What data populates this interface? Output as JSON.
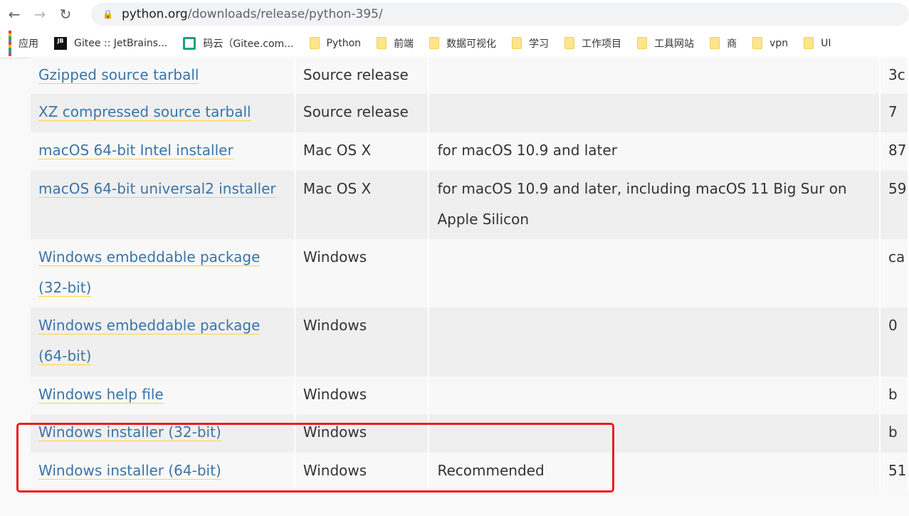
{
  "browser": {
    "url_host": "python.org",
    "url_path": "/downloads/release/python-395/",
    "bookmarks": [
      {
        "label": "应用",
        "icon": "apps-grid-icon"
      },
      {
        "label": "Gitee :: JetBrains...",
        "icon": "jetbrains-icon"
      },
      {
        "label": "码云（Gitee.com...",
        "icon": "gitee-icon"
      },
      {
        "label": "Python",
        "icon": "folder-icon"
      },
      {
        "label": "前端",
        "icon": "folder-icon"
      },
      {
        "label": "数据可视化",
        "icon": "folder-icon"
      },
      {
        "label": "学习",
        "icon": "folder-icon"
      },
      {
        "label": "工作项目",
        "icon": "folder-icon"
      },
      {
        "label": "工具网站",
        "icon": "folder-icon"
      },
      {
        "label": "商",
        "icon": "folder-icon"
      },
      {
        "label": "vpn",
        "icon": "folder-icon"
      },
      {
        "label": "UI",
        "icon": "folder-icon"
      }
    ]
  },
  "files": [
    {
      "version": "Gzipped source tarball",
      "os": "Source release",
      "description": "",
      "md5": "3c"
    },
    {
      "version": "XZ compressed source tarball",
      "os": "Source release",
      "description": "",
      "md5": "7"
    },
    {
      "version": "macOS 64-bit Intel installer",
      "os": "Mac OS X",
      "description": "for macOS 10.9 and later",
      "md5": "87"
    },
    {
      "version": "macOS 64-bit universal2 installer",
      "os": "Mac OS X",
      "description": "for macOS 10.9 and later, including macOS 11 Big Sur on Apple Silicon",
      "md5": "59"
    },
    {
      "version": "Windows embeddable package (32-bit)",
      "os": "Windows",
      "description": "",
      "md5": "ca"
    },
    {
      "version": "Windows embeddable package (64-bit)",
      "os": "Windows",
      "description": "",
      "md5": "0"
    },
    {
      "version": "Windows help file",
      "os": "Windows",
      "description": "",
      "md5": "b"
    },
    {
      "version": "Windows installer (32-bit)",
      "os": "Windows",
      "description": "",
      "md5": "b"
    },
    {
      "version": "Windows installer (64-bit)",
      "os": "Windows",
      "description": "Recommended",
      "md5": "51"
    }
  ],
  "colors": {
    "link": "#3b74a8",
    "link_underline": "#ffd343",
    "highlight_box": "#ee1c1c"
  }
}
